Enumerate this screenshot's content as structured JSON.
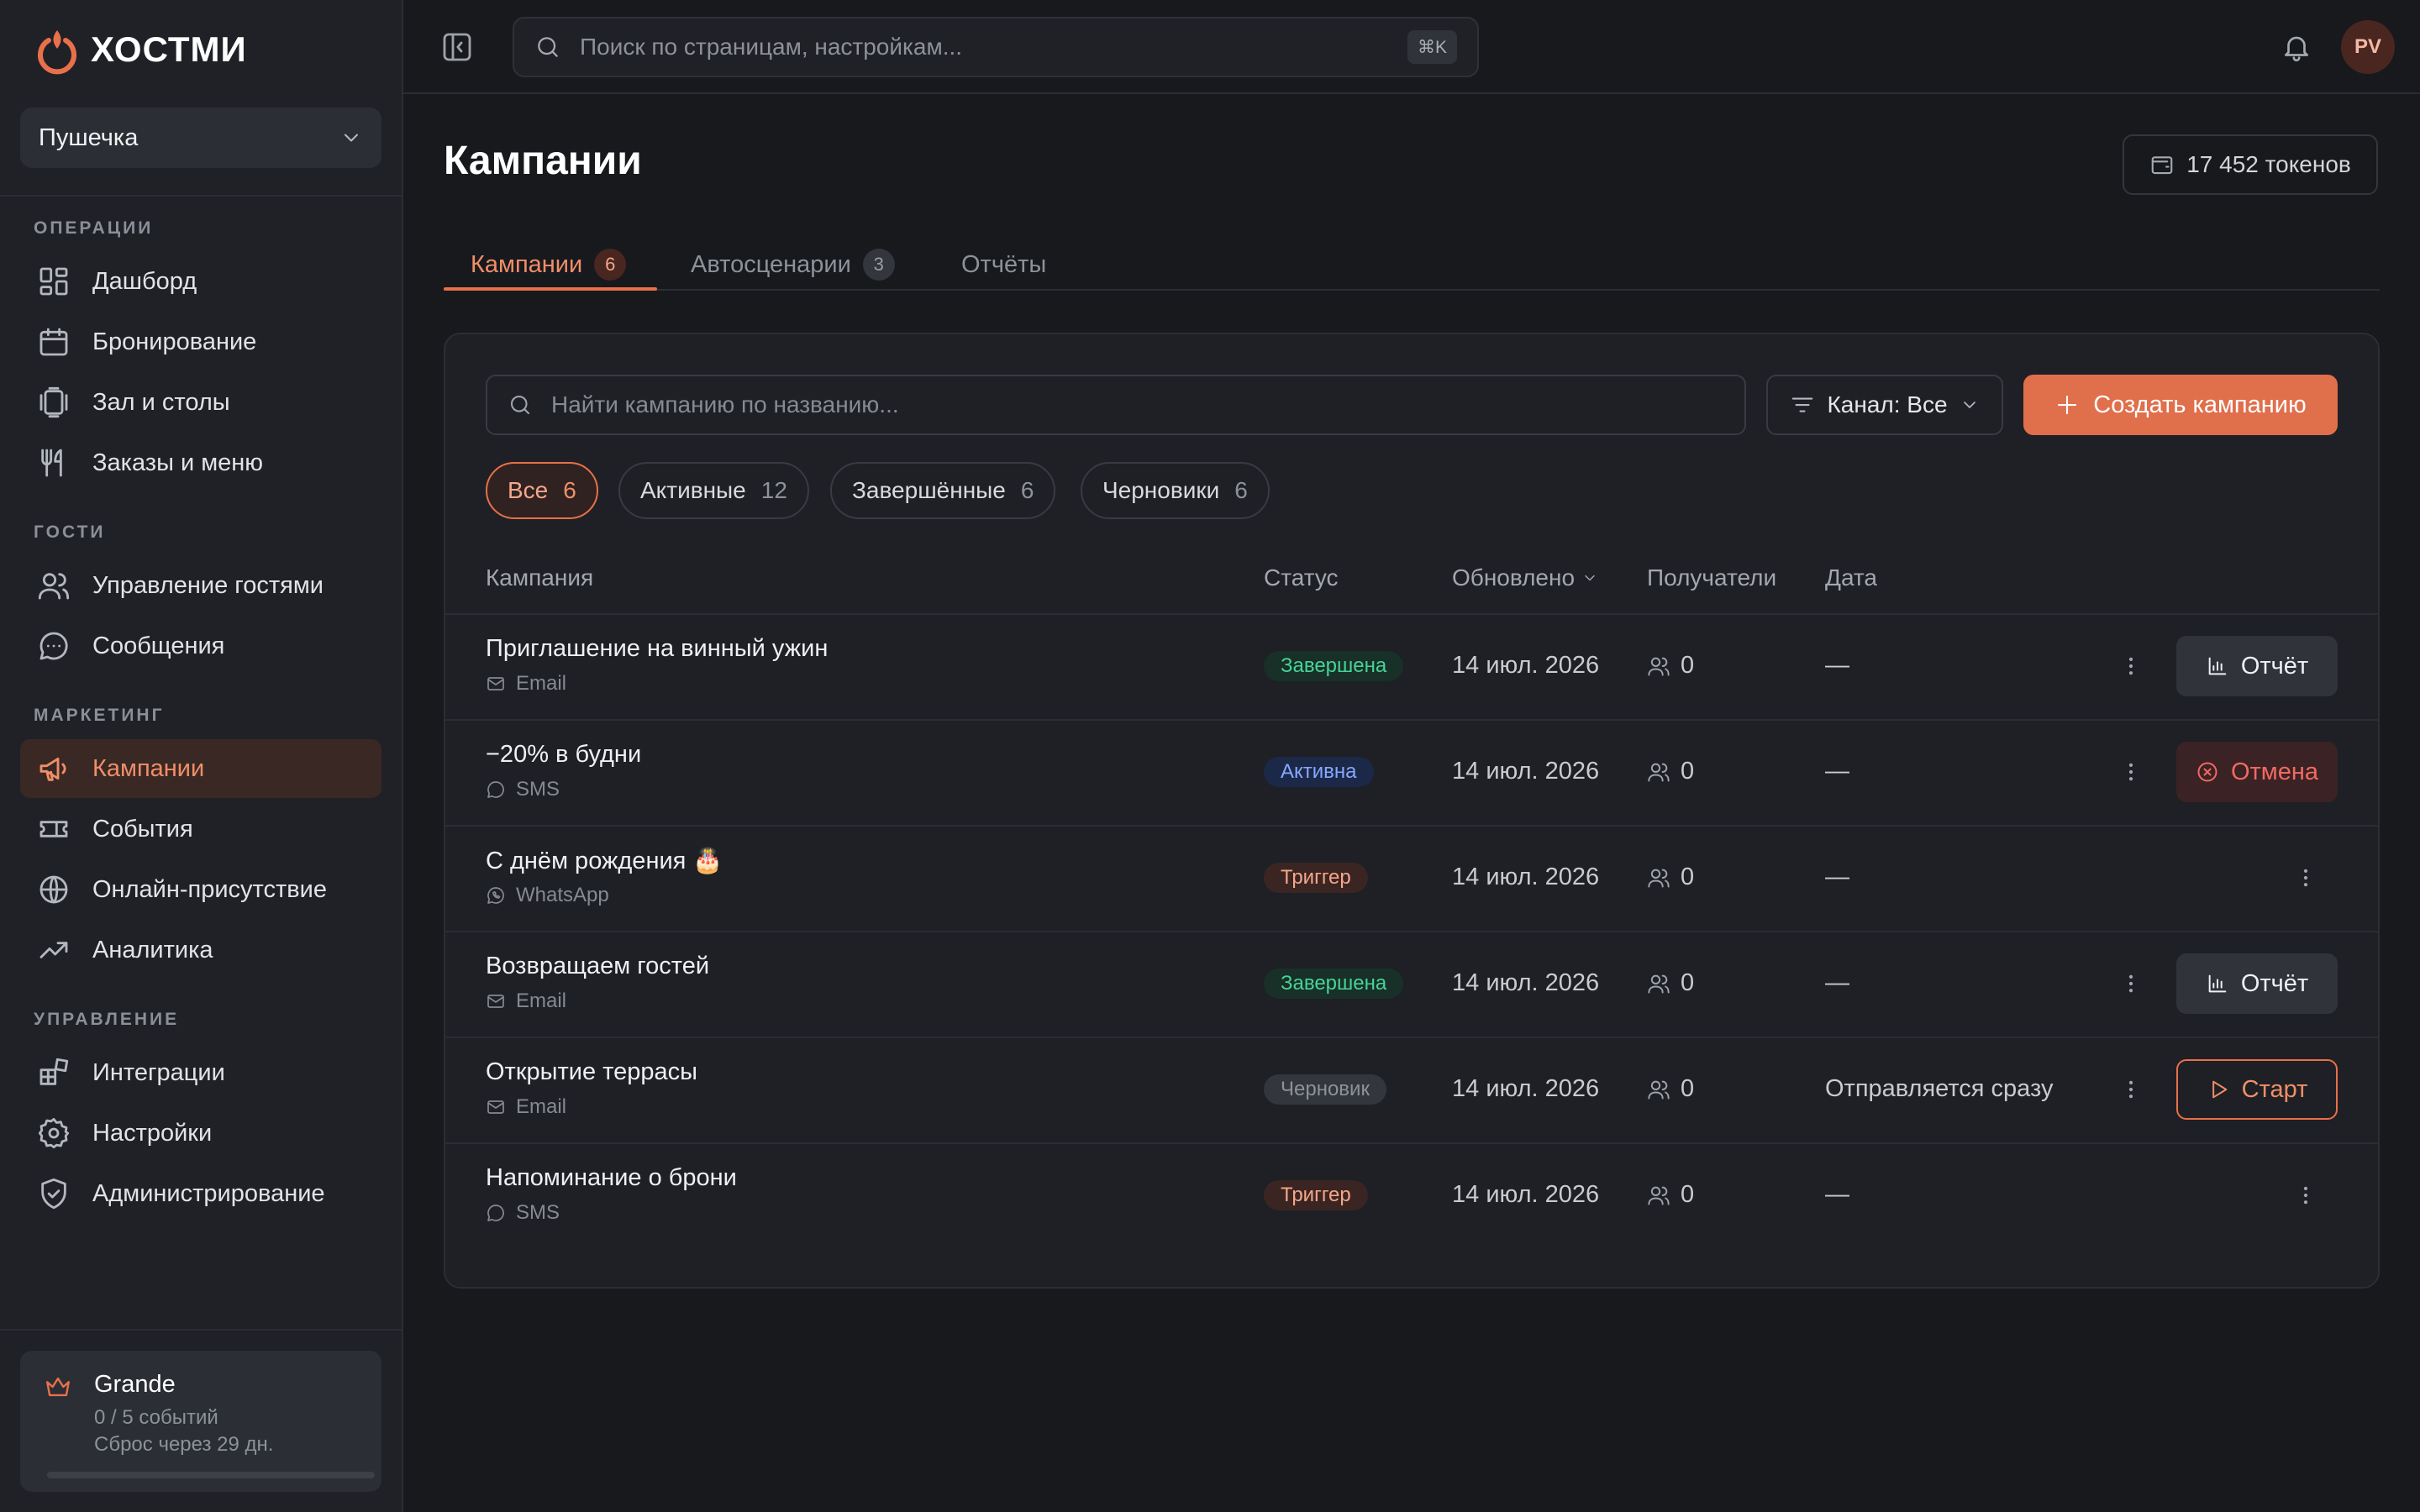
{
  "app": {
    "logo_text": "ХОСТМИ",
    "accent": "#e8704a"
  },
  "sidebar": {
    "workspace": "Пушечка",
    "sections": [
      {
        "title": "ОПЕРАЦИИ",
        "items": [
          {
            "label": "Дашборд",
            "icon": "dashboard-icon"
          },
          {
            "label": "Бронирование",
            "icon": "calendar-icon"
          },
          {
            "label": "Зал и столы",
            "icon": "tables-icon"
          },
          {
            "label": "Заказы и меню",
            "icon": "utensils-icon"
          }
        ]
      },
      {
        "title": "ГОСТИ",
        "items": [
          {
            "label": "Управление гостями",
            "icon": "users-icon"
          },
          {
            "label": "Сообщения",
            "icon": "chat-icon"
          }
        ]
      },
      {
        "title": "МАРКЕТИНГ",
        "items": [
          {
            "label": "Кампании",
            "icon": "megaphone-icon",
            "active": true
          },
          {
            "label": "События",
            "icon": "ticket-icon"
          },
          {
            "label": "Онлайн-присутствие",
            "icon": "globe-icon"
          },
          {
            "label": "Аналитика",
            "icon": "trending-icon"
          }
        ]
      },
      {
        "title": "УПРАВЛЕНИЕ",
        "items": [
          {
            "label": "Интеграции",
            "icon": "integrations-icon"
          },
          {
            "label": "Настройки",
            "icon": "gear-icon"
          },
          {
            "label": "Администрирование",
            "icon": "shield-icon"
          }
        ]
      }
    ],
    "plan": {
      "name": "Grande",
      "usage": "0 / 5 событий",
      "reset": "Сброс через 29 дн.",
      "progress": 0
    }
  },
  "topbar": {
    "search_placeholder": "Поиск по страницам, настройкам...",
    "shortcut": "⌘K",
    "avatar_initials": "PV"
  },
  "page": {
    "title": "Кампании",
    "tokens": "17 452 токенов",
    "tabs": [
      {
        "label": "Кампании",
        "count": "6",
        "active": true
      },
      {
        "label": "Автосценарии",
        "count": "3"
      },
      {
        "label": "Отчёты"
      }
    ]
  },
  "toolbar": {
    "search_placeholder": "Найти кампанию по названию...",
    "channel_filter": "Канал: Все",
    "create_label": "Создать кампанию"
  },
  "filters": [
    {
      "label": "Все",
      "count": "6",
      "active": true
    },
    {
      "label": "Активные",
      "count": "12"
    },
    {
      "label": "Завершённые",
      "count": "6"
    },
    {
      "label": "Черновики",
      "count": "6"
    }
  ],
  "table": {
    "columns": {
      "name": "Кампания",
      "status": "Статус",
      "updated": "Обновлено",
      "recipients": "Получатели",
      "date": "Дата"
    },
    "rows": [
      {
        "name": "Приглашение на винный ужин",
        "channel": "Email",
        "channel_icon": "mail-icon",
        "status": "Завершена",
        "status_kind": "done",
        "updated": "14 июл. 2026",
        "recipients": "0",
        "date": "—",
        "action": "Отчёт",
        "action_kind": "report"
      },
      {
        "name": "−20% в будни",
        "channel": "SMS",
        "channel_icon": "sms-icon",
        "status": "Активна",
        "status_kind": "active",
        "updated": "14 июл. 2026",
        "recipients": "0",
        "date": "—",
        "action": "Отмена",
        "action_kind": "cancel"
      },
      {
        "name": "С днём рождения 🎂",
        "channel": "WhatsApp",
        "channel_icon": "whatsapp-icon",
        "status": "Триггер",
        "status_kind": "trigger",
        "updated": "14 июл. 2026",
        "recipients": "0",
        "date": "—"
      },
      {
        "name": "Возвращаем гостей",
        "channel": "Email",
        "channel_icon": "mail-icon",
        "status": "Завершена",
        "status_kind": "done",
        "updated": "14 июл. 2026",
        "recipients": "0",
        "date": "—",
        "action": "Отчёт",
        "action_kind": "report"
      },
      {
        "name": "Открытие террасы",
        "channel": "Email",
        "channel_icon": "mail-icon",
        "status": "Черновик",
        "status_kind": "draft",
        "updated": "14 июл. 2026",
        "recipients": "0",
        "date": "Отправляется сразу",
        "action": "Старт",
        "action_kind": "start"
      },
      {
        "name": "Напоминание о брони",
        "channel": "SMS",
        "channel_icon": "sms-icon",
        "status": "Триггер",
        "status_kind": "trigger",
        "updated": "14 июл. 2026",
        "recipients": "0",
        "date": "—"
      }
    ]
  }
}
